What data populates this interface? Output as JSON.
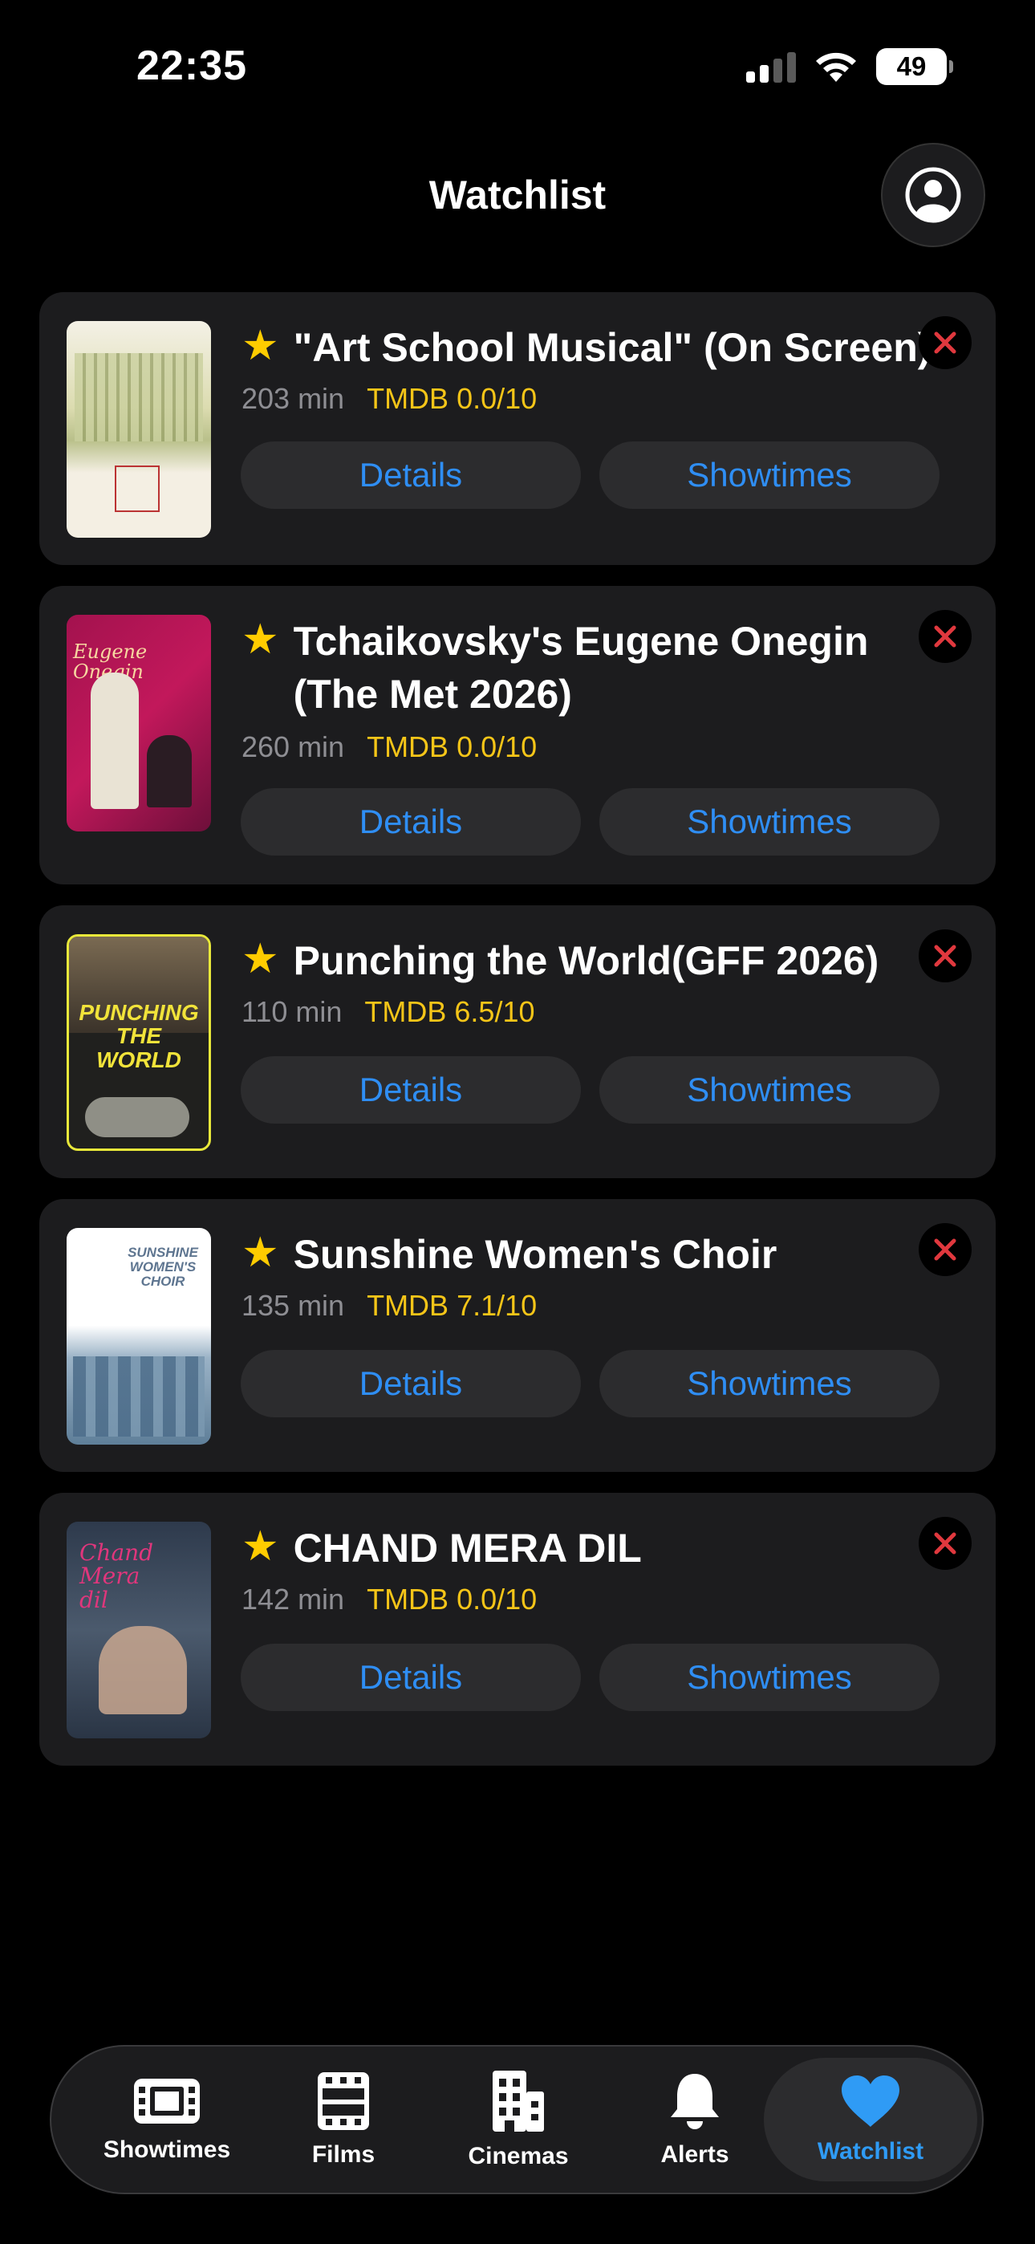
{
  "status": {
    "time": "22:35",
    "battery": "49"
  },
  "header": {
    "title": "Watchlist"
  },
  "films": [
    {
      "title": "\"Art School Musical\" (On Screen)",
      "runtime": "203 min",
      "rating": "TMDB 0.0/10",
      "details_label": "Details",
      "showtimes_label": "Showtimes"
    },
    {
      "title": "Tchaikovsky's Eugene Onegin (The Met 2026)",
      "runtime": "260 min",
      "rating": "TMDB 0.0/10",
      "details_label": "Details",
      "showtimes_label": "Showtimes",
      "poster_text": "Eugene Onegin"
    },
    {
      "title": "Punching the World(GFF 2026)",
      "runtime": "110 min",
      "rating": "TMDB 6.5/10",
      "details_label": "Details",
      "showtimes_label": "Showtimes",
      "poster_text": "PUNCHING THE WORLD"
    },
    {
      "title": "Sunshine Women's Choir",
      "runtime": "135 min",
      "rating": "TMDB 7.1/10",
      "details_label": "Details",
      "showtimes_label": "Showtimes",
      "poster_text": "SUNSHINE WOMEN'S CHOIR"
    },
    {
      "title": "CHAND MERA DIL",
      "runtime": "142 min",
      "rating": "TMDB 0.0/10",
      "details_label": "Details",
      "showtimes_label": "Showtimes",
      "poster_text": "Chand Mera dil"
    }
  ],
  "tabs": [
    {
      "label": "Showtimes",
      "icon": "film-strip-icon"
    },
    {
      "label": "Films",
      "icon": "film-reel-icon"
    },
    {
      "label": "Cinemas",
      "icon": "building-icon"
    },
    {
      "label": "Alerts",
      "icon": "bell-icon"
    },
    {
      "label": "Watchlist",
      "icon": "heart-icon",
      "active": true
    }
  ],
  "colors": {
    "accent": "#2f8ef4",
    "star": "#ffcc00",
    "rating": "#f5c518",
    "remove": "#e0383e"
  }
}
